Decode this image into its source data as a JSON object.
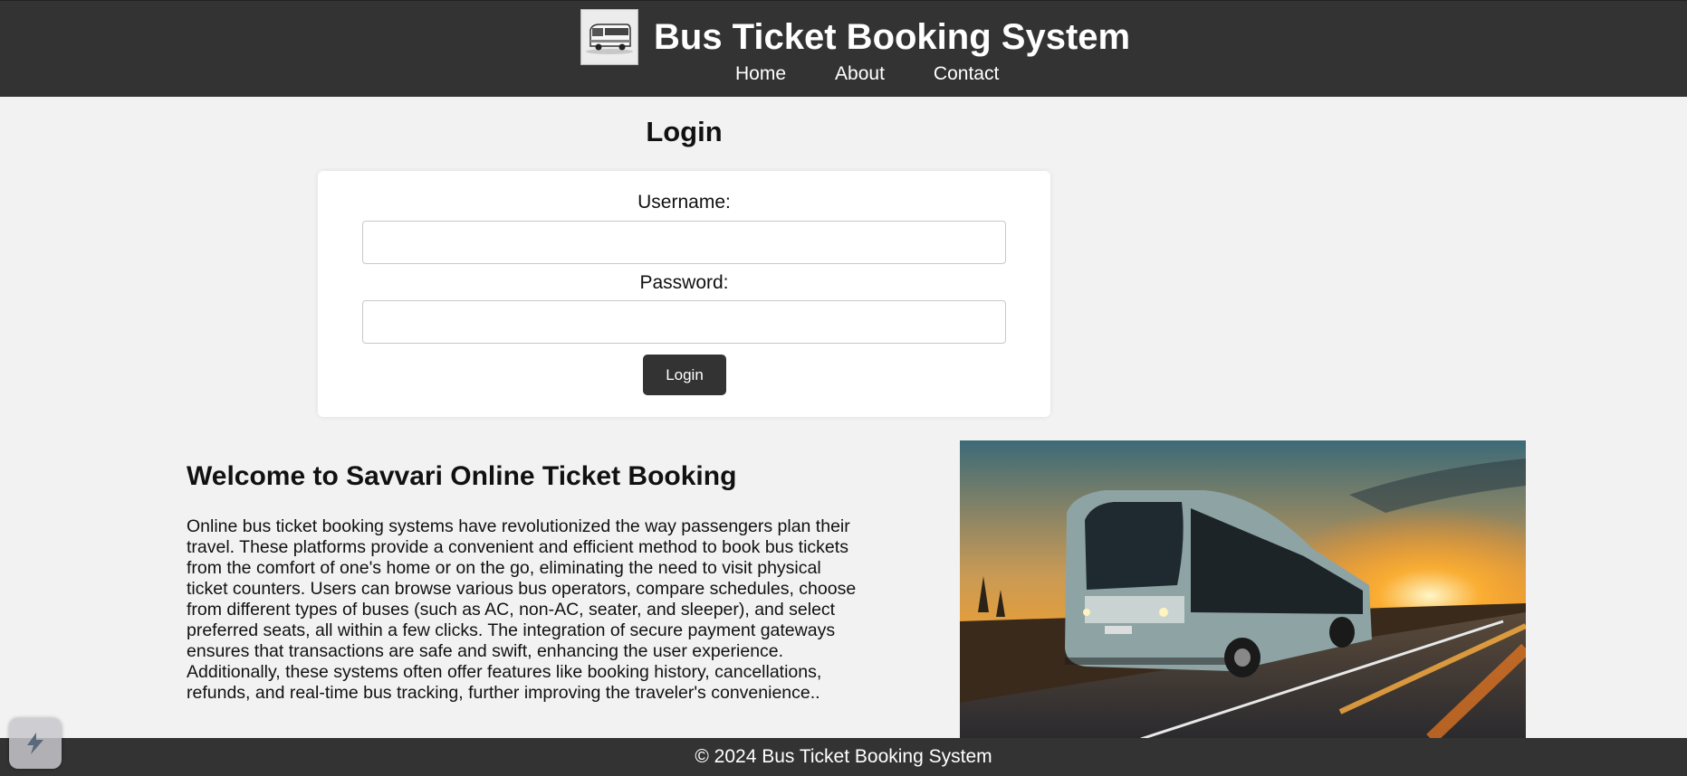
{
  "header": {
    "title": "Bus Ticket Booking System",
    "logo_icon": "bus-logo-icon",
    "background": "#333333",
    "nav": [
      {
        "label": "Home"
      },
      {
        "label": "About"
      },
      {
        "label": "Contact"
      }
    ]
  },
  "login": {
    "heading": "Login",
    "username_label": "Username:",
    "username_value": "",
    "password_label": "Password:",
    "password_value": "",
    "submit_label": "Login"
  },
  "welcome": {
    "title": "Welcome to Savvari Online Ticket Booking",
    "body": "Online bus ticket booking systems have revolutionized the way passengers plan their travel. These platforms provide a convenient and efficient method to book bus tickets from the comfort of one's home or on the go, eliminating the need to visit physical ticket counters. Users can browse various bus operators, compare schedules, choose from different types of buses (such as AC, non-AC, seater, and sleeper), and select preferred seats, all within a few clicks. The integration of secure payment gateways ensures that transactions are safe and swift, enhancing the user experience. Additionally, these systems often offer features like booking history, cancellations, refunds, and real-time bus tracking, further improving the traveler's convenience..",
    "image_icon": "bus-sunset-photo"
  },
  "footer": {
    "text": "© 2024 Bus Ticket Booking System"
  },
  "widget": {
    "icon": "floating-widget-icon"
  }
}
